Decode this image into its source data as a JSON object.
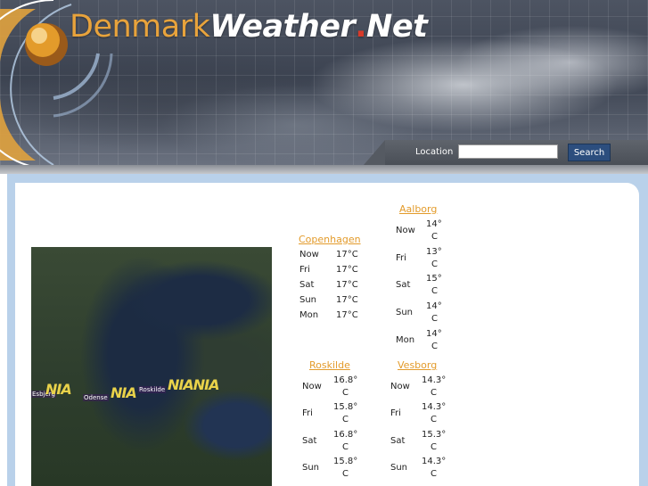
{
  "header": {
    "title_part1": "Denmark",
    "title_part2": "Weather",
    "title_dot": ".",
    "title_part3": "Net",
    "location_label": "Location",
    "location_value": "",
    "search_button": "Search",
    "logo_icon": "globe-icon"
  },
  "map": {
    "labels": [
      "Esbjerg",
      "Odense",
      "Roskilde"
    ],
    "badges": [
      "NIA",
      "NIA",
      "NIANIA"
    ]
  },
  "cities": {
    "copenhagen": {
      "name": "Copenhagen",
      "rows": [
        {
          "day": "Now",
          "temp": "17°C"
        },
        {
          "day": "Fri",
          "temp": "17°C"
        },
        {
          "day": "Sat",
          "temp": "17°C"
        },
        {
          "day": "Sun",
          "temp": "17°C"
        },
        {
          "day": "Mon",
          "temp": "17°C"
        }
      ]
    },
    "aalborg": {
      "name": "Aalborg",
      "rows": [
        {
          "day": "Now",
          "temp_a": "14°",
          "temp_b": "C"
        },
        {
          "day": "Fri",
          "temp_a": "13°",
          "temp_b": "C"
        },
        {
          "day": "Sat",
          "temp_a": "15°",
          "temp_b": "C"
        },
        {
          "day": "Sun",
          "temp_a": "14°",
          "temp_b": "C"
        },
        {
          "day": "Mon",
          "temp_a": "14°",
          "temp_b": "C"
        }
      ]
    },
    "roskilde": {
      "name": "Roskilde",
      "rows": [
        {
          "day": "Now",
          "temp_a": "16.8°",
          "temp_b": "C"
        },
        {
          "day": "Fri",
          "temp_a": "15.8°",
          "temp_b": "C"
        },
        {
          "day": "Sat",
          "temp_a": "16.8°",
          "temp_b": "C"
        },
        {
          "day": "Sun",
          "temp_a": "15.8°",
          "temp_b": "C"
        }
      ]
    },
    "vesborg": {
      "name": "Vesborg",
      "rows": [
        {
          "day": "Now",
          "temp_a": "14.3°",
          "temp_b": "C"
        },
        {
          "day": "Fri",
          "temp_a": "14.3°",
          "temp_b": "C"
        },
        {
          "day": "Sat",
          "temp_a": "15.3°",
          "temp_b": "C"
        },
        {
          "day": "Sun",
          "temp_a": "14.3°",
          "temp_b": "C"
        }
      ]
    }
  },
  "colors": {
    "link": "#e39b2b",
    "search_button": "#2c4e7e",
    "content_frame": "#b9d1ea"
  }
}
